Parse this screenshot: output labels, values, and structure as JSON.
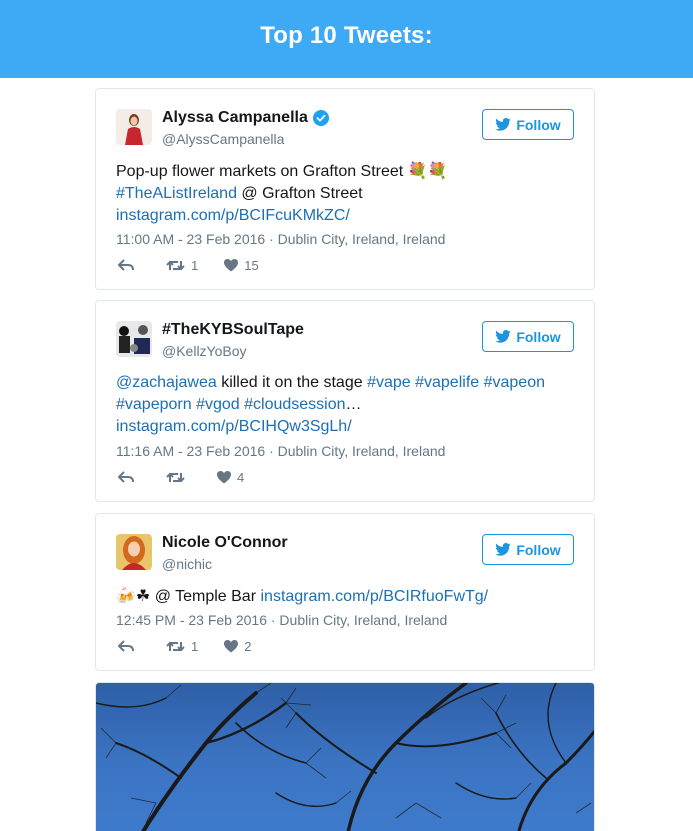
{
  "header": {
    "title": "Top 10 Tweets:"
  },
  "follow_label": "Follow",
  "colors": {
    "header_bg": "#3ea9f5",
    "link": "#1b6fb5",
    "accent": "#1b95e0"
  },
  "tweets": [
    {
      "name": "Alyssa Campanella",
      "handle": "@AlyssCampanella",
      "verified": true,
      "text_plain": "Pop-up flower markets on Grafton Street ",
      "emoji": "💐💐",
      "hashtag": "#TheAListIreland",
      "location_text": " @ Grafton Street",
      "link": "instagram.com/p/BCIFcuKMkZC/",
      "meta": "11:00 AM - 23 Feb 2016 · Dublin City, Ireland, Ireland",
      "retweets": "1",
      "likes": "15"
    },
    {
      "name": "#TheKYBSoulTape",
      "handle": "@KellzYoBoy",
      "verified": false,
      "mention": "@zachajawea",
      "text_plain": " killed it on the stage ",
      "tags": [
        "#vape",
        "#vapelife",
        "#vapeon",
        "#vapeporn",
        "#vgod",
        "#cloudsession"
      ],
      "ellipsis": "…",
      "link": "instagram.com/p/BCIHQw3SgLh/",
      "meta": "11:16 AM - 23 Feb 2016 · Dublin City, Ireland, Ireland",
      "retweets": "",
      "likes": "4"
    },
    {
      "name": "Nicole O'Connor",
      "handle": "@nichic",
      "verified": false,
      "emoji": "🍻☘",
      "text_plain": " @ Temple Bar ",
      "link": "instagram.com/p/BCIRfuoFwTg/",
      "meta": "12:45 PM - 23 Feb 2016 · Dublin City, Ireland, Ireland",
      "retweets": "1",
      "likes": "2"
    }
  ]
}
